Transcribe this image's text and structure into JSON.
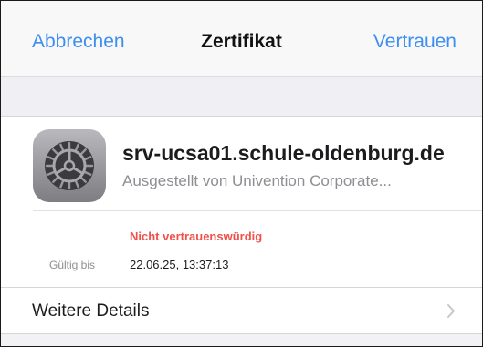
{
  "navbar": {
    "cancel_label": "Abbrechen",
    "title": "Zertifikat",
    "trust_label": "Vertrauen"
  },
  "certificate": {
    "icon": "gear-icon",
    "host": "srv-ucsa01.schule-oldenburg.de",
    "issuer": "Ausgestellt von Univention Corporate...",
    "trust_status": "Nicht vertrauenswürdig",
    "valid_until_label": "Gültig bis",
    "valid_until_value": "22.06.25, 13:37:13"
  },
  "details": {
    "label": "Weitere Details",
    "icon": "chevron-right-icon"
  },
  "colors": {
    "accent": "#3d8ef0",
    "warning": "#f0514a"
  }
}
